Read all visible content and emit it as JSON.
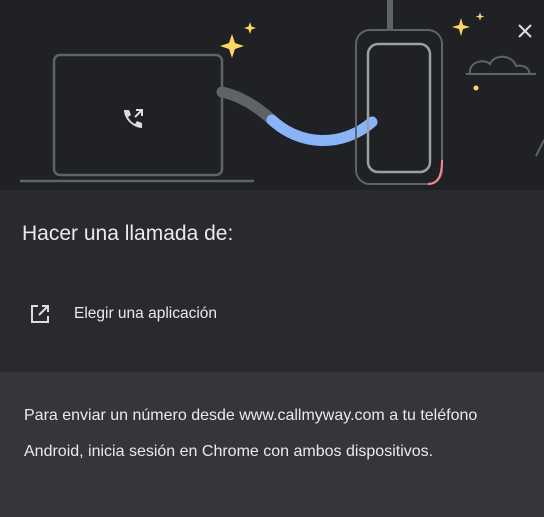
{
  "dialog": {
    "close_icon": "close-icon",
    "title": "Hacer una llamada de:",
    "option": {
      "icon": "open-in-new-icon",
      "label": "Elegir una aplicación"
    },
    "footer": {
      "text": "Para enviar un número desde www.callmyway.com a tu teléfono Android, inicia sesión en Chrome con ambos dispositivos."
    }
  },
  "colors": {
    "background": "#292a2d",
    "hero_background": "#202124",
    "footer_background": "#35363a",
    "cable_accent": "#8ab4f8",
    "sparkle": "#fdd663",
    "phone_edge_accent": "#f28b82",
    "text": "#e8eaed"
  }
}
